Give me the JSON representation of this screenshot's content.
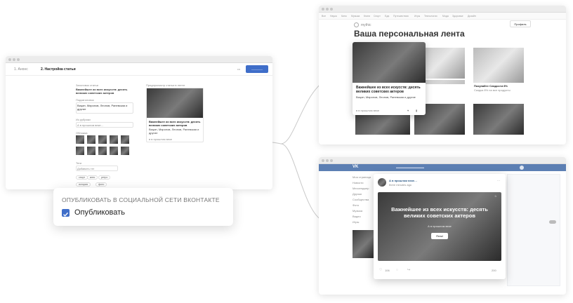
{
  "editor": {
    "step1": "1. Анонс",
    "step2": "2. Настройка статьи",
    "button_label": "————",
    "left_label": "Заголовок статьи",
    "title_text": "Важнейшее из всех искусств: десять великих советских актеров",
    "subtitle_label": "Подзаголовок",
    "subtitle_text": "Вицин, Миронов, Леонов, Раневская и другие",
    "author_label": "Из рубрики",
    "author_value": "А в прошлом веке…",
    "gallery_label": "Обложка",
    "tags_label": "Теги",
    "tags_placeholder": "Добавить тег",
    "tags": [
      "спорт",
      "кино",
      "ретро",
      "история",
      "фото"
    ],
    "preview_label": "Предпросмотр статьи в ленте",
    "preview_title": "Важнейшее из всех искусств: десять великих советских актеров",
    "preview_subtitle": "Вицин, Миронов, Леонов, Раневская и другие",
    "preview_meta": "в в прошлом веке"
  },
  "publish_card": {
    "heading": "ОПУБЛИКОВАТЬ В СОЦИАЛЬНОЙ СЕТИ ВКОНТАКТЕ",
    "checkbox_label": "Опубликовать",
    "checked": true,
    "accent": "#3f6ec9"
  },
  "feed": {
    "logo": "mythic",
    "profile": "Профиль",
    "heading": "Ваша персональная лента",
    "nav": [
      "Все",
      "Наука",
      "Кино",
      "Музыка",
      "Книги",
      "Спорт",
      "Еда",
      "Путешествия",
      "Игры",
      "Технологии",
      "Мода",
      "Здоровье",
      "Дизайн"
    ],
    "featured_title": "Важнейшее из всех искусств: десять великих советских актеров",
    "featured_subtitle": "Вицин, Миронов, Леонов, Раневская и другие",
    "featured_meta": "в в прошлом веке",
    "side_card_title": "Покупайте Сладости 8%",
    "side_card_text": "Скидка 8% на все продукты"
  },
  "vk": {
    "logo": "VK",
    "search_placeholder": "▬▬▬▬▬▬▬▬▬▬",
    "post_author": "А в прошлом веке…",
    "post_time": "three minutes ago",
    "article_title": "Важнейшее из всех искусств: десять великих советских актеров",
    "article_author": "А в прошлом веке",
    "read_button": "Read",
    "likes": "106",
    "views": "200",
    "menu": [
      "Моя страница",
      "Новости",
      "Мессенджер",
      "Друзья",
      "Сообщества",
      "Фото",
      "Музыка",
      "Видео",
      "Игры"
    ]
  },
  "colors": {
    "accent_blue": "#3f6ec9",
    "vk_header": "#5c7fb3",
    "connector": "#c9c9c9"
  }
}
